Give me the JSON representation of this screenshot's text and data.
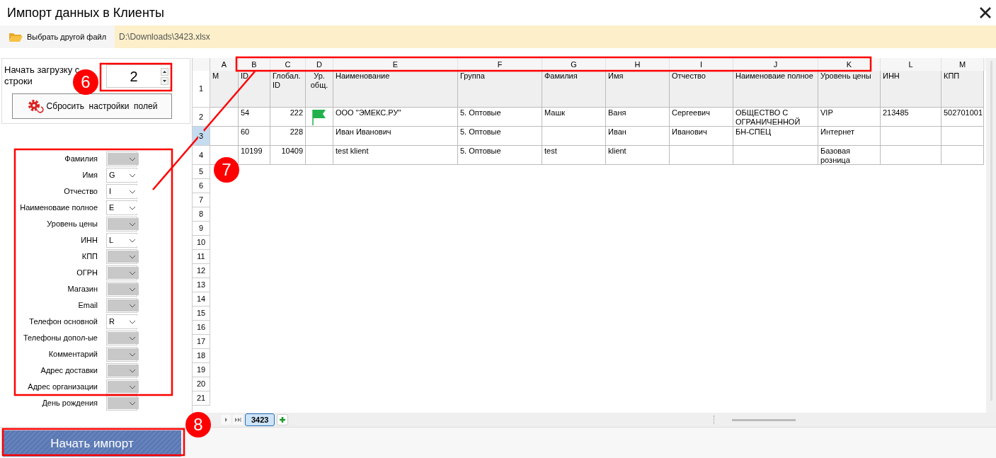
{
  "window": {
    "title": "Импорт данных в Клиенты"
  },
  "file_bar": {
    "button": "Выбрать другой файл",
    "path": "D:\\Downloads\\3423.xlsx"
  },
  "start_row": {
    "label_lines": [
      "Начать загрузку с",
      "строки"
    ],
    "value": "2"
  },
  "reset_button": "Сбросить  настройки  полей",
  "fields": [
    {
      "label": "Фамилия"
    },
    {
      "label": "Имя",
      "value": "G"
    },
    {
      "label": "Отчество",
      "value": "I"
    },
    {
      "label": "Наименоваие полное",
      "value": "E"
    },
    {
      "label": "Уровень цены"
    },
    {
      "label": "ИНН",
      "value": "L"
    },
    {
      "label": "КПП"
    },
    {
      "label": "ОГРН"
    },
    {
      "label": "Магазин"
    },
    {
      "label": "Email"
    },
    {
      "label": "Телефон основной",
      "value": "R"
    },
    {
      "label": "Телефоны допол-ые"
    },
    {
      "label": "Комментарий"
    },
    {
      "label": "Адрес доставки"
    },
    {
      "label": "Адрес организации"
    },
    {
      "label": "День рождения"
    }
  ],
  "columns": [
    "A",
    "B",
    "C",
    "D",
    "E",
    "F",
    "G",
    "H",
    "I",
    "J",
    "K",
    "L",
    "M"
  ],
  "row_headers": [
    {
      "label": "1",
      "selected": false
    },
    {
      "label": "2",
      "selected": false
    },
    {
      "label": "3",
      "selected": true
    },
    {
      "label": "4",
      "selected": false
    },
    {
      "label": "5",
      "selected": false
    },
    {
      "label": "6",
      "selected": false
    },
    {
      "label": "7",
      "selected": false
    },
    {
      "label": "8",
      "selected": false
    },
    {
      "label": "9",
      "selected": false
    },
    {
      "label": "10",
      "selected": false
    },
    {
      "label": "11",
      "selected": false
    },
    {
      "label": "12",
      "selected": false
    },
    {
      "label": "13",
      "selected": false
    },
    {
      "label": "14",
      "selected": false
    },
    {
      "label": "15",
      "selected": false
    },
    {
      "label": "16",
      "selected": false
    },
    {
      "label": "17",
      "selected": false
    },
    {
      "label": "18",
      "selected": false
    },
    {
      "label": "19",
      "selected": false
    },
    {
      "label": "20",
      "selected": false
    },
    {
      "label": "21",
      "selected": false
    }
  ],
  "rows": [
    {
      "kind": "header",
      "flag": false,
      "cells": {
        "A": "М",
        "B": "ID",
        "C": "Глобал. ID",
        "D": "Ур. общ.",
        "E": "Наименование",
        "F": "Группа",
        "G": "Фамилия",
        "H": "Имя",
        "I": "Отчество",
        "J": "Наименоваие полное",
        "K": "Уровень цены",
        "L": "ИНН",
        "M": "КПП"
      }
    },
    {
      "kind": "data",
      "flag": true,
      "cells": {
        "B": "54",
        "C": "222",
        "E": "ООО \"ЭМЕКС.РУ\"",
        "F": "5. Оптовые",
        "G": "Машк",
        "H": "Ваня",
        "I": "Сергеевич",
        "J": "ОБЩЕСТВО С ОГРАНИЧЕННОЙ",
        "K": "VIP",
        "L": "213485",
        "M": "502701001"
      }
    },
    {
      "kind": "data",
      "flag": false,
      "cells": {
        "B": "60",
        "C": "228",
        "E": "Иван Иванович",
        "F": "5. Оптовые",
        "H": "Иван",
        "I": "Иванович",
        "J": "БН-СПЕЦ",
        "K": "Интернет"
      }
    },
    {
      "kind": "data",
      "flag": false,
      "cells": {
        "B": "10199",
        "C": "10409",
        "E": "test klient",
        "F": "5. Оптовые",
        "G": "test",
        "H": "klient",
        "K": "Базовая розница"
      }
    }
  ],
  "sheet_tabs": [
    {
      "label": "3423",
      "selected": true
    }
  ],
  "import_button": "Начать импорт",
  "annotations": [
    {
      "number": "6"
    },
    {
      "number": "7"
    },
    {
      "number": "8"
    }
  ]
}
